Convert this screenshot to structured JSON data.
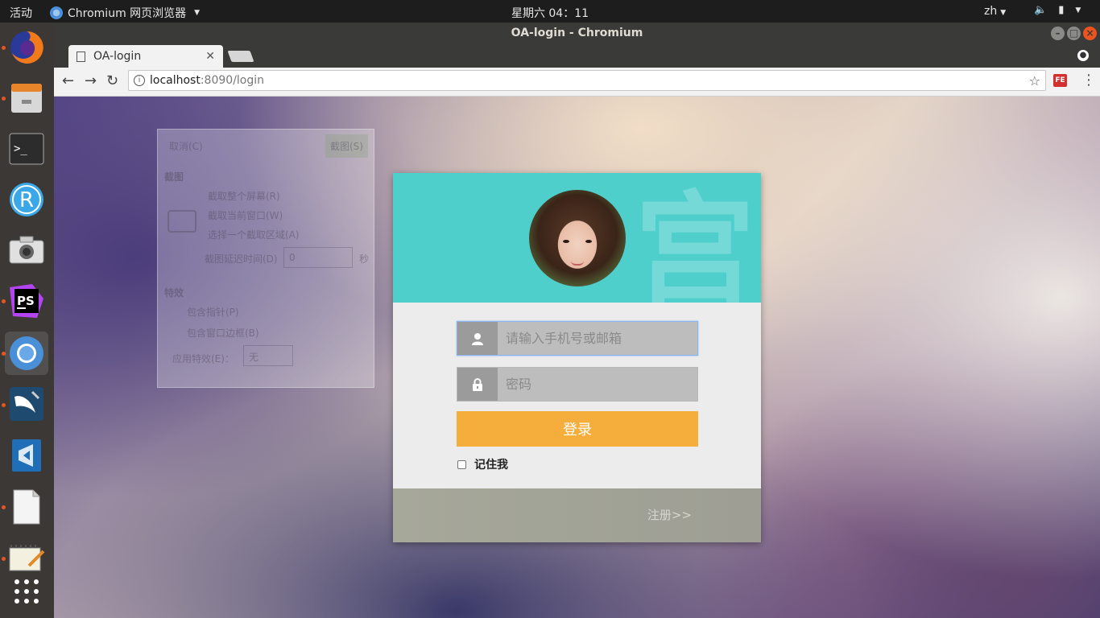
{
  "topbar": {
    "activities": "活动",
    "app_name": "Chromium 网页浏览器",
    "clock": "星期六 04：11",
    "lang": "zh"
  },
  "dock": {
    "items": [
      {
        "name": "firefox",
        "running": true
      },
      {
        "name": "files",
        "running": true
      },
      {
        "name": "terminal",
        "running": false
      },
      {
        "name": "rstudio",
        "running": false
      },
      {
        "name": "screenshot",
        "running": false
      },
      {
        "name": "phpstorm",
        "running": true
      },
      {
        "name": "chromium",
        "running": true,
        "active": true
      },
      {
        "name": "mysql-workbench",
        "running": true
      },
      {
        "name": "vscode",
        "running": false
      },
      {
        "name": "libreoffice",
        "running": true
      },
      {
        "name": "text-editor",
        "running": true
      },
      {
        "name": "show-apps",
        "running": false
      }
    ],
    "ps_label": "PS"
  },
  "window": {
    "title": "OA-login - Chromium",
    "tab_title": "OA-login",
    "url_host": "localhost",
    "url_path": ":8090/login",
    "ext_label": "FE"
  },
  "ghost_dialog": {
    "cancel": "取消(C)",
    "capture": "截图(S)",
    "section_capture": "截图",
    "opt_full": "截取整个屏幕(R)",
    "opt_window": "截取当前窗口(W)",
    "opt_area": "选择一个截取区域(A)",
    "delay_label": "截图延迟时间(D)",
    "delay_value": "0",
    "delay_unit": "秒",
    "section_effects": "特效",
    "pointer": "包含指针(P)",
    "border": "包含窗口边框(B)",
    "apply_effect": "应用特效(E)：",
    "effect_value": "无"
  },
  "login": {
    "deco_char": "宫",
    "username_placeholder": "请输入手机号或邮箱",
    "password_placeholder": "密码",
    "login_button": "登录",
    "remember_me": "记住我",
    "register_link": "注册>>"
  },
  "colors": {
    "header": "#4fcfcc",
    "login_button": "#f5ad3c",
    "footer": "#a6a89a"
  }
}
